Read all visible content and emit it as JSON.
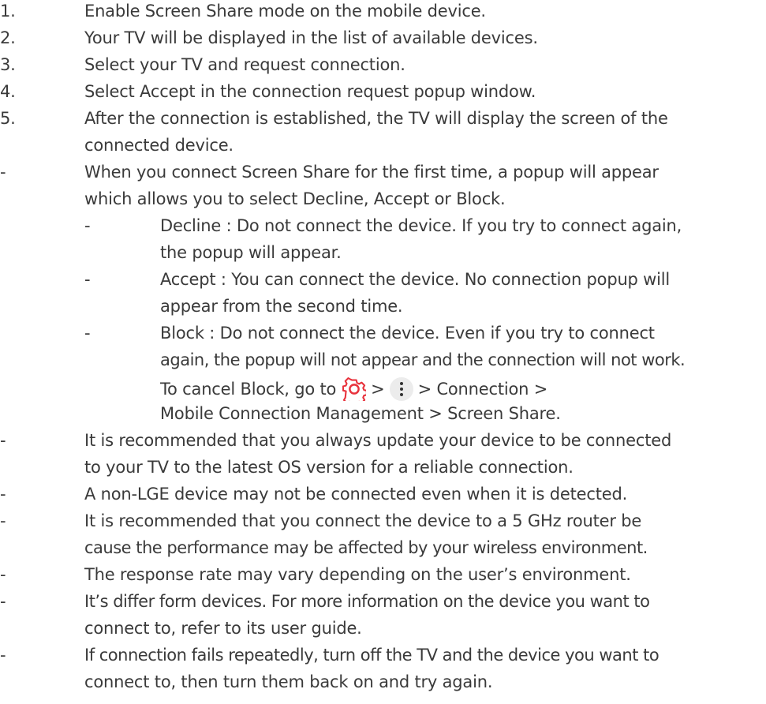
{
  "steps": [
    {
      "marker": "1.",
      "text": "Enable Screen Share mode on the mobile device."
    },
    {
      "marker": "2.",
      "text": "Your TV will be displayed in the list of available devices."
    },
    {
      "marker": "3.",
      "text": "Select your TV and request connection."
    },
    {
      "marker": "4.",
      "text": "Select Accept in the connection request popup window."
    },
    {
      "marker": "5.",
      "line1": "After the connection is established, the TV will display the screen of the",
      "line2": "connected device."
    }
  ],
  "popup_note": {
    "marker": "-",
    "line1": "When you connect Screen Share for the first time, a popup will appear",
    "line2": "which allows you to select Decline, Accept or Block.",
    "options": [
      {
        "marker": "-",
        "line1": "Decline : Do not connect the device. If you try to connect again,",
        "line2": "the popup will appear."
      },
      {
        "marker": "-",
        "line1": "Accept : You can connect the device. No connection popup will",
        "line2": "appear from the second time."
      },
      {
        "marker": "-",
        "line1": "Block : Do not connect the device. Even if you try to connect",
        "line2": "again, the popup will not appear and the connection will not work."
      }
    ],
    "cancel_path": {
      "prefix": "To cancel Block, go to",
      "sep1": ">",
      "sep2": "> Connection >",
      "line2": "Mobile Connection Management > Screen Share."
    }
  },
  "notes": [
    {
      "marker": "-",
      "line1": "It is recommended that you always update your device to be connected",
      "line2": "to your TV to the latest OS version for a reliable connection."
    },
    {
      "marker": "-",
      "line1": "A non-LGE device may not be connected even when it is detected."
    },
    {
      "marker": "-",
      "line1": "It is recommended that you connect the device to a 5 GHz router be",
      "line2": "cause the performance may be affected by your wireless environment."
    },
    {
      "marker": "-",
      "line1": "The response rate may vary depending on the user’s environment."
    },
    {
      "marker": "-",
      "line1": "It’s differ form devices. For more information on the device you want to",
      "line2": "connect to, refer to its user guide."
    },
    {
      "marker": "-",
      "line1": "If connection fails repeatedly, turn off the TV and the device you want to",
      "line2": "connect to, then turn them back on and try again."
    }
  ],
  "icons": {
    "settings": "gear-icon",
    "more": "more-vertical-icon",
    "settings_color": "#e8323c"
  }
}
